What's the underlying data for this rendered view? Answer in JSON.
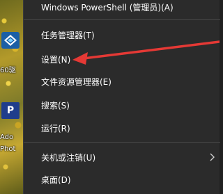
{
  "desktop": {
    "labels": [
      "60驱",
      "Ado",
      "Phot"
    ],
    "icon_letters": [
      "",
      "P"
    ]
  },
  "menu": {
    "items": [
      {
        "key": "powershell_admin",
        "label": "Windows PowerShell (管理员)(A)"
      },
      {
        "key": "task_manager",
        "label": "任务管理器(T)"
      },
      {
        "key": "settings",
        "label": "设置(N)"
      },
      {
        "key": "file_explorer",
        "label": "文件资源管理器(E)"
      },
      {
        "key": "search",
        "label": "搜索(S)"
      },
      {
        "key": "run",
        "label": "运行(R)"
      },
      {
        "key": "shutdown_signout",
        "label": "关机或注销(U)"
      },
      {
        "key": "desktop",
        "label": "桌面(D)"
      }
    ]
  },
  "colors": {
    "menu_bg": "#2b2b2b",
    "text": "#ffffff",
    "annotation_arrow": "#e53935"
  },
  "icons": {
    "submenu": "chevron-right-icon",
    "annotation": "red-arrow-pointer"
  }
}
